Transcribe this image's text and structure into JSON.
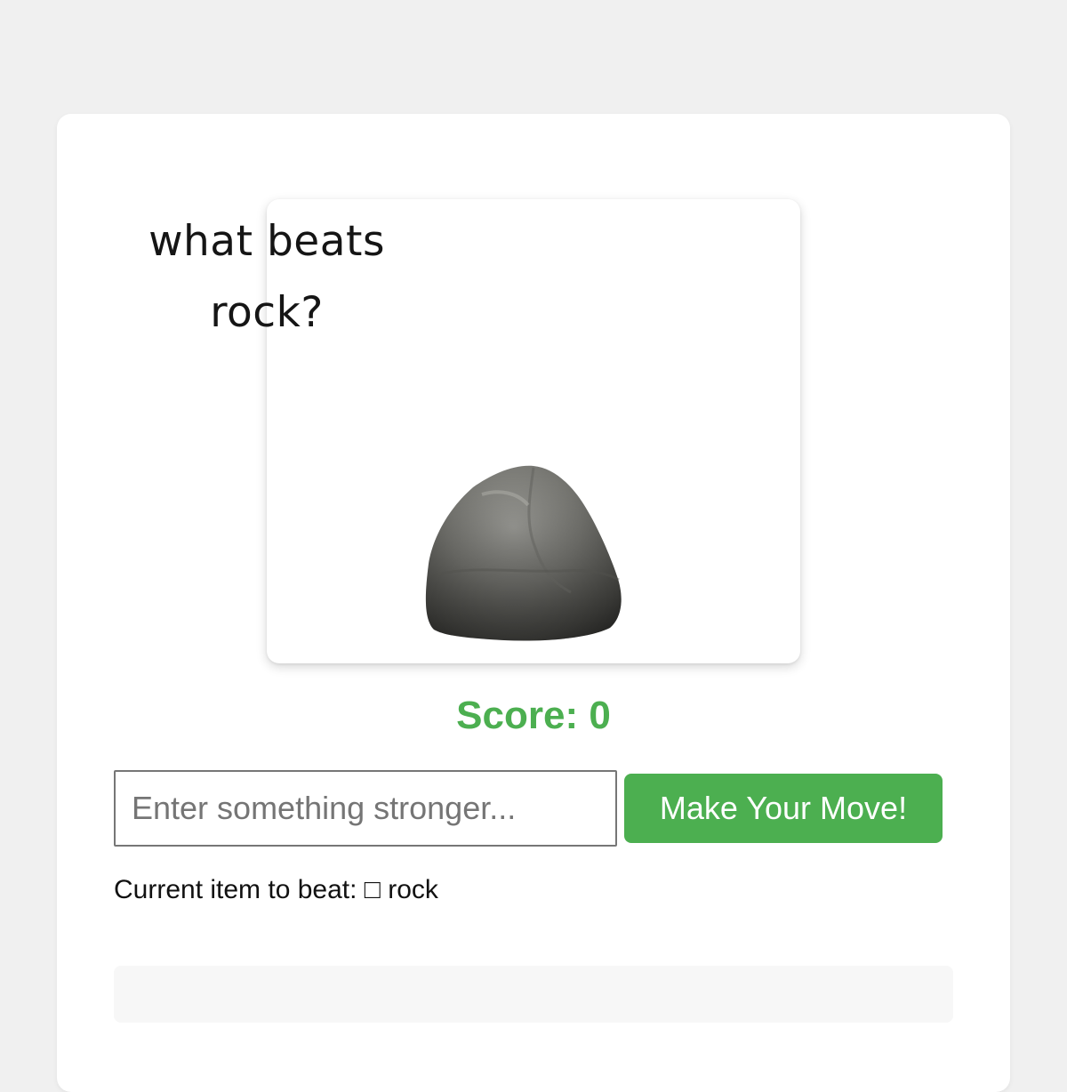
{
  "hero": {
    "caption_line1": "what beats",
    "caption_line2": "rock?",
    "image": "rock-image"
  },
  "score": {
    "text": "Score: 0",
    "value": 0
  },
  "input": {
    "placeholder": "Enter something stronger...",
    "value": ""
  },
  "button": {
    "label": "Make Your Move!"
  },
  "current_item": {
    "text": "Current item to beat: □ rock"
  },
  "colors": {
    "page_background": "#f0f0f0",
    "card_background": "#ffffff",
    "accent_green": "#4caf50",
    "result_area": "#f7f7f7"
  }
}
